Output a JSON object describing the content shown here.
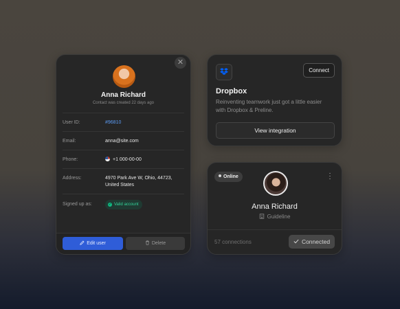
{
  "profile": {
    "name": "Anna Richard",
    "created": "Contact was created 22 days ago",
    "rows": [
      {
        "label": "User ID:",
        "value": "#96810"
      },
      {
        "label": "Email:",
        "value": "anna@site.com"
      },
      {
        "label": "Phone:",
        "value": "+1 000-00-00"
      },
      {
        "label": "Address:",
        "value": "4970 Park Ave W, Ohio, 44723, United States"
      },
      {
        "label": "Signed up as:",
        "value": "Valid account"
      }
    ],
    "edit_label": "Edit user",
    "delete_label": "Delete",
    "close_icon": "close-icon"
  },
  "dropbox": {
    "title": "Dropbox",
    "description": "Reinventing teamwork just got a little easier with Dropbox & Preline.",
    "connect_label": "Connect",
    "view_label": "View integration",
    "brand_color": "#0061fe"
  },
  "user": {
    "status": "Online",
    "name": "Anna Richard",
    "role": "Guideline",
    "connections": "57 connections",
    "connected_label": "Connected"
  },
  "colors": {
    "accent": "#2f5dd8",
    "valid": "#34d399",
    "link": "#5b9cf5"
  }
}
